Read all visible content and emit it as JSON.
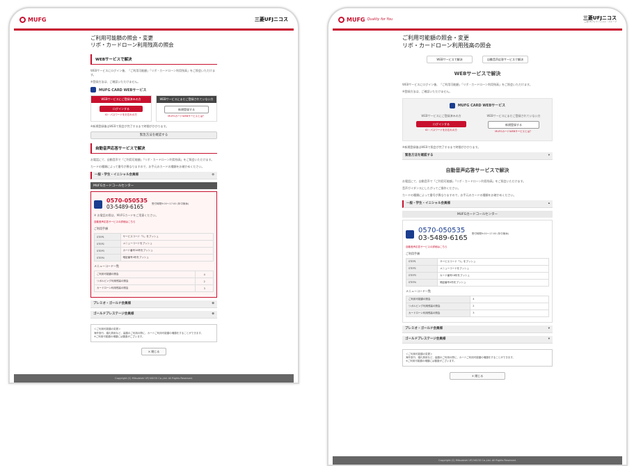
{
  "header": {
    "brand": "MUFG",
    "brand_tagline": "Quality for You",
    "company": "三菱UFJニコス",
    "company_sub": "三菱UFJフィナンシャル・グループ"
  },
  "page": {
    "title_line1": "ご利用可能額の照会・変更",
    "title_line2": "リボ・カードローン利用残高の照会"
  },
  "nav": {
    "web_button": "WEBサービスで解決",
    "voice_button": "自動音声応答サービスで解決"
  },
  "web_section": {
    "heading": "WEBサービスで解決",
    "text1": "WEBサービスにログイン後、「ご利用可能額」「リボ・カードローン利用残高」をご照会いただけます。",
    "text2": "※登録方法は、ご確認いただけません。",
    "card_title": "MUFG CARD WEBサービス",
    "registered_head": "WEBサービスにご登録済みの方",
    "not_registered_head": "WEBサービスにまだご登録されていない方",
    "login_button": "ログインする",
    "new_register_button": "新規登録する",
    "id_forgot": "ID・パスワードをお忘れの方",
    "about_web": "MUFGカードWEBサービスとは？",
    "note": "※新規登録後はWEBで照会が完了するまで時間がかかります。",
    "emergency_button": "緊急方法を確認する"
  },
  "voice_section": {
    "heading": "自動音声応答サービスで解決",
    "text1": "お電話にて、自動音声で「ご利用可能額」「リボ・カードローン利用残高」をご照会いただけます。",
    "text2": "音声ガイダンスにしたがってご操作ください。",
    "text3": "カードの種類によって番号が異なりますので、お手元のカードの種類をお確かめください。"
  },
  "accordion": {
    "general": "一般・学生・イニシャル会員様",
    "premier": "プレミオ・ゴールド会員様",
    "gold_prestige": "ゴールドプレステージ会員様"
  },
  "call_center": {
    "name": "MUFGカードコールセンター",
    "tel_navi": "0570-050535",
    "tel_label": "または",
    "tel_alt": "03-5489-6165",
    "hours": "受付時間9:00～17:00 (年中無休)",
    "notes": "※ お電話の際は、MUFGカードをご用意ください。",
    "guide_link": "自動音声応答サービスの詳細はこちら"
  },
  "steps": {
    "label": "ご利用手順",
    "rows": [
      {
        "step": "STEP1",
        "text": "サービスコード「1」をプッシュ"
      },
      {
        "step": "STEP2",
        "text": "メニューコードをプッシュ"
      },
      {
        "step": "STEP3",
        "text": "カード番号16桁をプッシュ"
      },
      {
        "step": "STEP4",
        "text": "暗証番号4桁をプッシュ"
      }
    ]
  },
  "menu": {
    "label": "メニューコード一覧",
    "rows": [
      {
        "item": "ご利用可能額の照会",
        "code": "4"
      },
      {
        "item": "リボルビング利用残高の照会",
        "code": "2"
      },
      {
        "item": "カードローン利用残高の照会",
        "code": "3"
      }
    ]
  },
  "note_box": {
    "title": "＜ご利用可能額の変更＞",
    "line1": "海外旅行、婚礼費用など、高額のご利用の際に、カードご利用可能額の増額をすることができます。",
    "line2": "※ご利用可能額の増額には審査がございます。"
  },
  "close_button": "閉じる",
  "footer": "Copyright (C) Mitsubishi UFJ NICOS Co.,Ltd. All Rights Reserved."
}
